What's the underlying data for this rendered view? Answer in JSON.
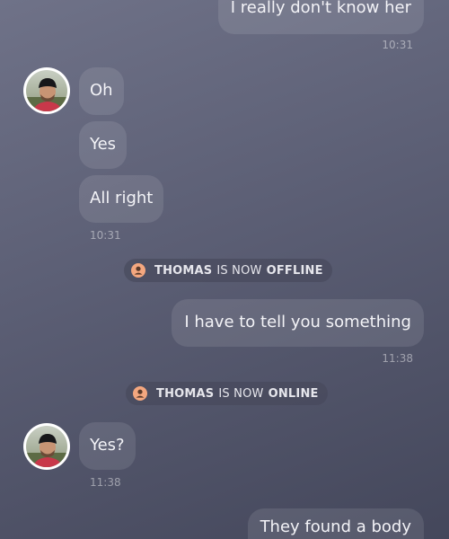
{
  "messages": [
    {
      "side": "out",
      "text": "I really don't know her",
      "time": "10:31"
    },
    {
      "side": "in",
      "text": "Oh"
    },
    {
      "side": "in",
      "text": "Yes"
    },
    {
      "side": "in",
      "text": "All right",
      "time": "10:31"
    },
    {
      "side": "out",
      "text": "I have to tell you something",
      "time": "11:38"
    },
    {
      "side": "in",
      "text": "Yes?",
      "time": "11:38"
    },
    {
      "side": "out",
      "text": "They found a body"
    }
  ],
  "status_events": [
    {
      "name": "THOMAS",
      "middle": "IS NOW",
      "state": "OFFLINE"
    },
    {
      "name": "THOMAS",
      "middle": "IS NOW",
      "state": "ONLINE"
    }
  ],
  "icons": {
    "avatar": "contact-avatar-photo",
    "status": "user-icon"
  },
  "colors": {
    "background_top": "#6f7288",
    "background_bottom": "#44475b",
    "bubble": "rgba(255,255,255,0.10)",
    "status_icon": "#f4a77f"
  }
}
